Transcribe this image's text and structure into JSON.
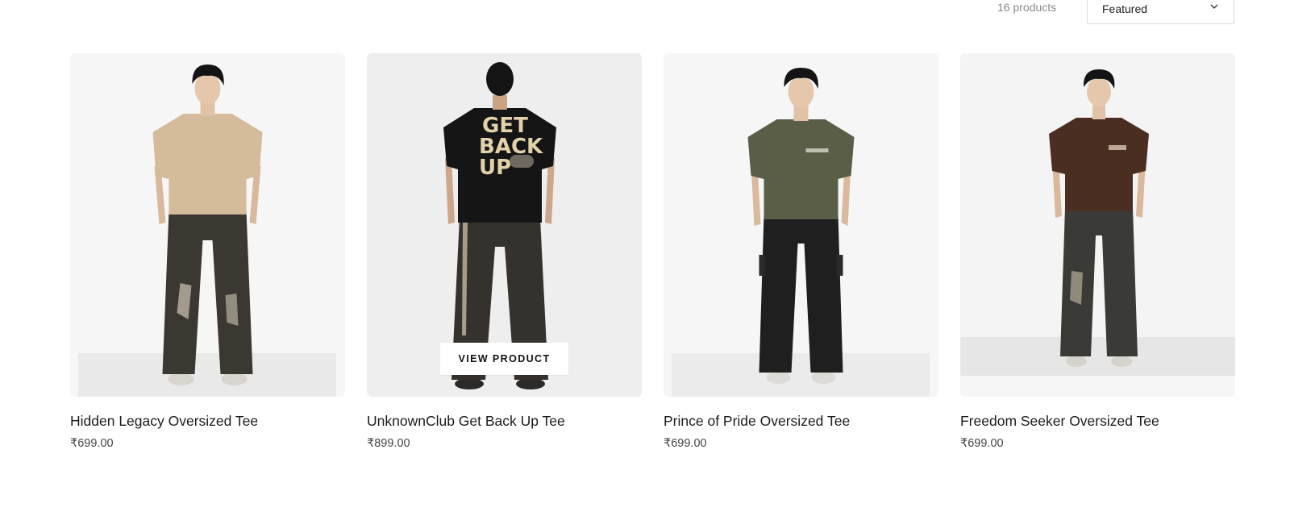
{
  "toolbar": {
    "product_count": "16 products",
    "sort": {
      "selected": "Featured"
    }
  },
  "products": [
    {
      "title": "Hidden Legacy Oversized Tee",
      "price": "₹699.00",
      "bg": "#f6f6f6",
      "tee_color": "#d3bb9c",
      "pants_color": "#3b3832",
      "tee_print": "",
      "hovered": false
    },
    {
      "title": "UnknownClub Get Back Up Tee",
      "price": "₹899.00",
      "bg": "#eeeeee",
      "tee_color": "#151515",
      "pants_color": "#35322d",
      "tee_print": "GET BACK UP",
      "hovered": true,
      "hover_button": "VIEW PRODUCT"
    },
    {
      "title": "Prince of Pride Oversized Tee",
      "price": "₹699.00",
      "bg": "#f6f6f6",
      "tee_color": "#5a5e47",
      "pants_color": "#1f1f1f",
      "tee_print": "",
      "hovered": false
    },
    {
      "title": "Freedom Seeker Oversized Tee",
      "price": "₹699.00",
      "bg": "#f4f4f4",
      "tee_color": "#4a2e22",
      "pants_color": "#3a3a36",
      "tee_print": "",
      "hovered": false
    }
  ]
}
